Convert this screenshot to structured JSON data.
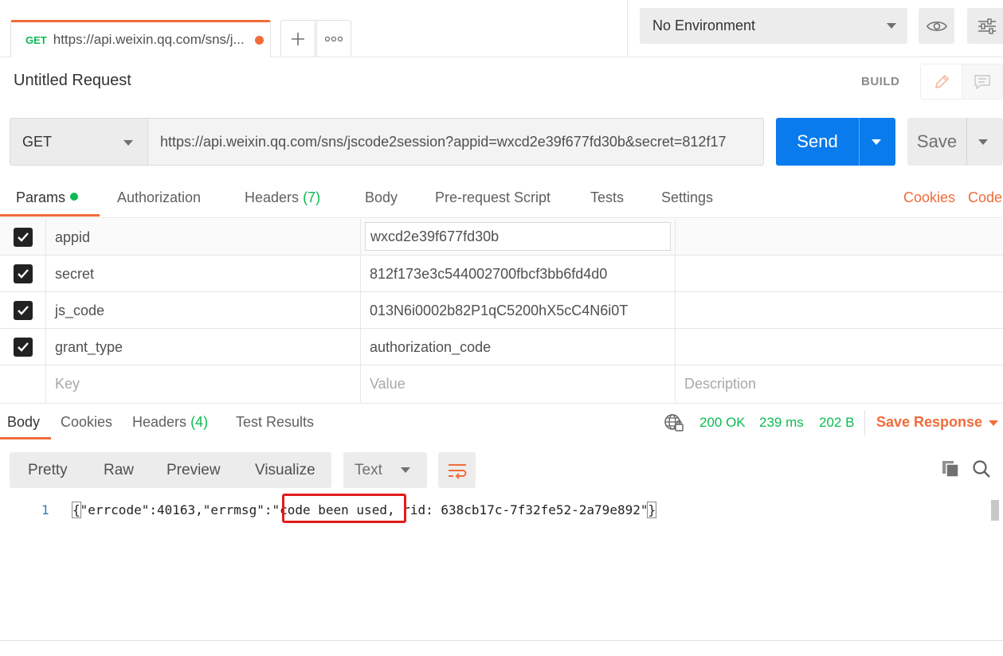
{
  "tabs": {
    "active": {
      "method": "GET",
      "url": "https://api.weixin.qq.com/sns/j..."
    }
  },
  "environment": {
    "selected": "No Environment"
  },
  "request": {
    "title": "Untitled Request",
    "build_label": "BUILD",
    "method": "GET",
    "url": "https://api.weixin.qq.com/sns/jscode2session?appid=wxcd2e39f677fd30b&secret=812f17",
    "send_label": "Send",
    "save_label": "Save"
  },
  "request_tabs": {
    "params": "Params",
    "authorization": "Authorization",
    "headers": "Headers",
    "headers_count": "(7)",
    "body": "Body",
    "prerequest": "Pre-request Script",
    "tests": "Tests",
    "settings": "Settings",
    "cookies": "Cookies",
    "code": "Code"
  },
  "params": {
    "rows": [
      {
        "key": "appid",
        "value": "wxcd2e39f677fd30b",
        "checked": true
      },
      {
        "key": "secret",
        "value": "812f173e3c544002700fbcf3bb6fd4d0",
        "checked": true
      },
      {
        "key": "js_code",
        "value": "013N6i0002b82P1qC5200hX5cC4N6i0T",
        "checked": true
      },
      {
        "key": "grant_type",
        "value": "authorization_code",
        "checked": true
      }
    ],
    "placeholder": {
      "key": "Key",
      "value": "Value",
      "description": "Description"
    }
  },
  "response_tabs": {
    "body": "Body",
    "cookies": "Cookies",
    "headers": "Headers",
    "headers_count": "(4)",
    "test_results": "Test Results"
  },
  "response_status": {
    "status": "200 OK",
    "time": "239 ms",
    "size": "202 B",
    "save_response": "Save Response"
  },
  "response_view": {
    "pretty": "Pretty",
    "raw": "Raw",
    "preview": "Preview",
    "visualize": "Visualize",
    "format": "Text"
  },
  "response_body": {
    "line_number": "1",
    "open_brace": "{",
    "part1": "\"errcode\":40163,\"errmsg\":\"",
    "highlighted": "code been used,",
    "part2": " rid: 638cb17c-7f32fe52-2a79e892\"",
    "close_brace": "}"
  },
  "colors": {
    "accent": "#f26b3a",
    "send": "#097bed",
    "success": "#0cbb52",
    "highlight_border": "#e31b1b"
  }
}
